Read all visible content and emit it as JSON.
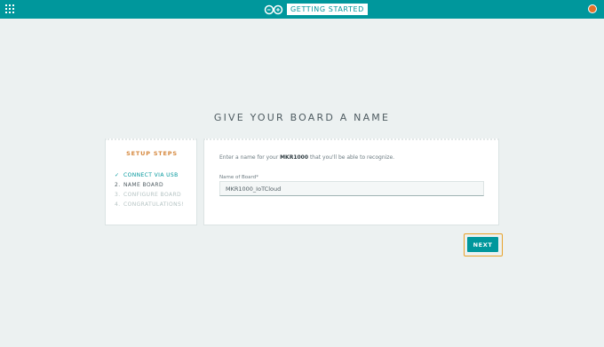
{
  "header": {
    "title": "GETTING STARTED",
    "icons": {
      "apps": "grid-icon",
      "logo": "arduino-logo-icon",
      "user": "user-avatar-icon"
    }
  },
  "colors": {
    "brand": "#00979c",
    "accent": "#d6893f",
    "user": "#e47128",
    "highlight": "#e8a22a",
    "background": "#ecf1f1"
  },
  "main": {
    "title": "GIVE YOUR BOARD A NAME"
  },
  "steps": {
    "title": "SETUP STEPS",
    "items": [
      {
        "mark": "✓",
        "label": "CONNECT VIA USB",
        "state": "completed"
      },
      {
        "mark": "2.",
        "label": "NAME BOARD",
        "state": "current"
      },
      {
        "mark": "3.",
        "label": "CONFIGURE BOARD",
        "state": "pending"
      },
      {
        "mark": "4.",
        "label": "CONGRATULATIONS!",
        "state": "pending"
      }
    ]
  },
  "form": {
    "intro_before": "Enter a name for your ",
    "board_model": "MKR1000",
    "intro_after": " that you'll be able to recognize.",
    "field_label": "Name of Board*",
    "field_value": "MKR1000_IoTCloud"
  },
  "actions": {
    "next_label": "NEXT"
  }
}
